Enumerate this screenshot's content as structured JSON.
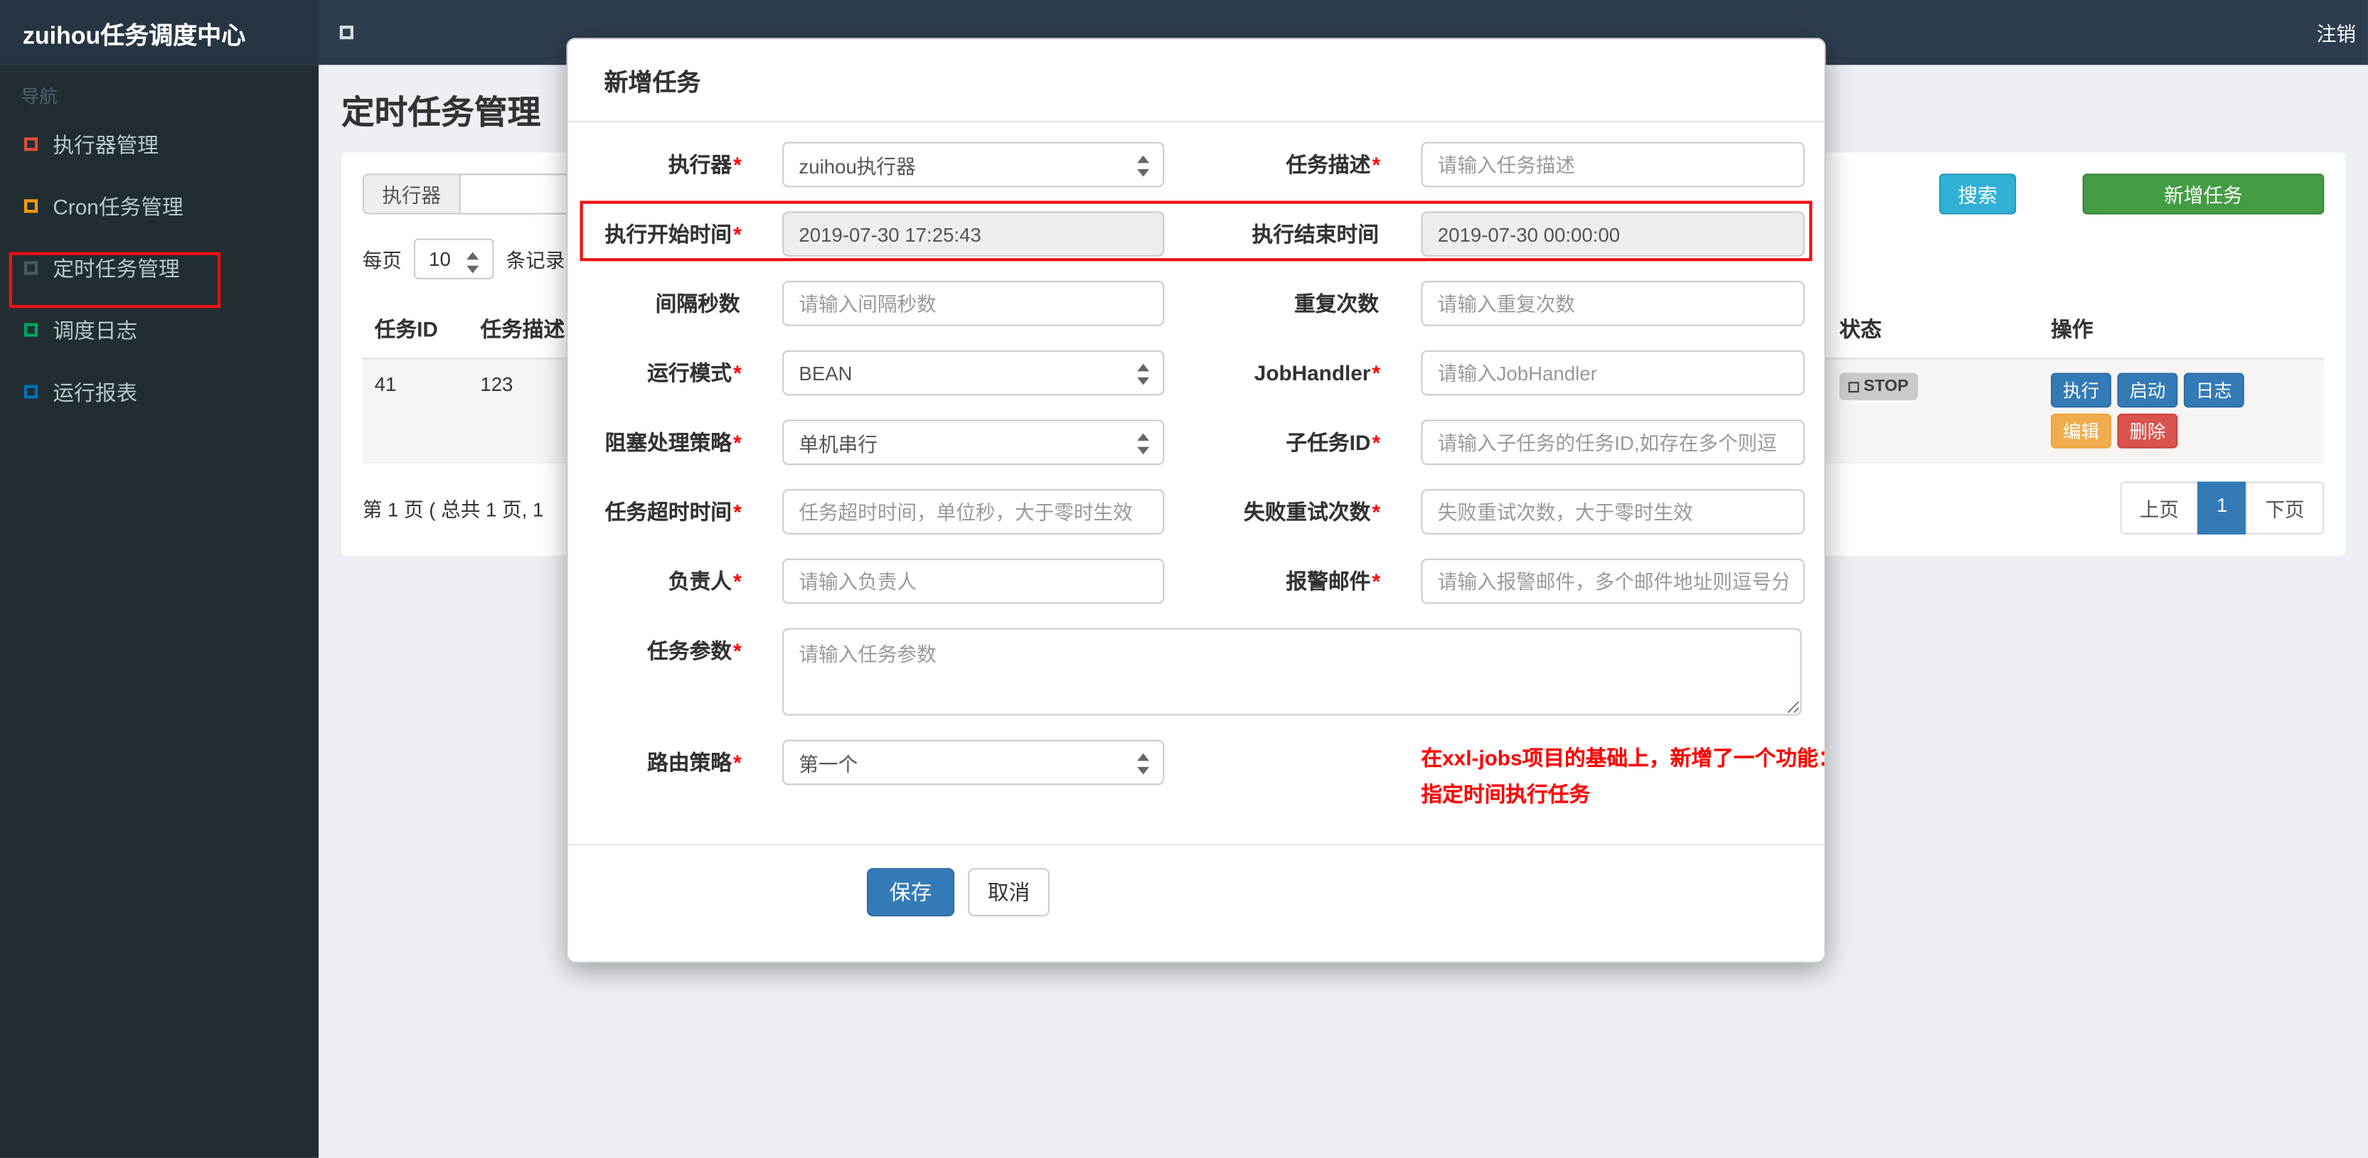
{
  "navbar": {
    "brand": "zuihou任务调度中心",
    "logout": "注销"
  },
  "sidebar": {
    "header": "导航",
    "items": [
      {
        "label": "执行器管理",
        "icon_color": "#dd4b39"
      },
      {
        "label": "Cron任务管理",
        "icon_color": "#f39c12"
      },
      {
        "label": "定时任务管理",
        "icon_color": "#455a64"
      },
      {
        "label": "调度日志",
        "icon_color": "#00a65a"
      },
      {
        "label": "运行报表",
        "icon_color": "#0073b7"
      }
    ]
  },
  "page": {
    "title": "定时任务管理"
  },
  "filter": {
    "executor_label": "执行器",
    "search": "搜索",
    "add_task": "新增任务"
  },
  "per_page": {
    "prefix": "每页",
    "value": "10",
    "suffix": "条记录"
  },
  "table": {
    "headers": [
      "任务ID",
      "任务描述",
      "状态",
      "操作"
    ],
    "row": {
      "id": "41",
      "desc": "123",
      "status": "STOP",
      "ops": [
        "执行",
        "启动",
        "日志",
        "编辑",
        "删除"
      ]
    }
  },
  "pagination": {
    "info": "第 1 页 ( 总共 1 页, 1",
    "prev": "上页",
    "current": "1",
    "next": "下页"
  },
  "modal": {
    "title": "新增任务",
    "fields": {
      "executor": {
        "label": "执行器",
        "required": "*",
        "value": "zuihou执行器"
      },
      "job_desc": {
        "label": "任务描述",
        "required": "*",
        "placeholder": "请输入任务描述"
      },
      "start_time": {
        "label": "执行开始时间",
        "required": "*",
        "value": "2019-07-30 17:25:43"
      },
      "end_time": {
        "label": "执行结束时间",
        "required": "",
        "value": "2019-07-30 00:00:00"
      },
      "interval": {
        "label": "间隔秒数",
        "required": "",
        "placeholder": "请输入间隔秒数"
      },
      "repeat_count": {
        "label": "重复次数",
        "required": "",
        "placeholder": "请输入重复次数"
      },
      "glue_type": {
        "label": "运行模式",
        "required": "*",
        "value": "BEAN"
      },
      "job_handler": {
        "label": "JobHandler",
        "required": "*",
        "placeholder": "请输入JobHandler"
      },
      "block_strategy": {
        "label": "阻塞处理策略",
        "required": "*",
        "value": "单机串行"
      },
      "child_job": {
        "label": "子任务ID",
        "required": "*",
        "placeholder": "请输入子任务的任务ID,如存在多个则逗"
      },
      "timeout": {
        "label": "任务超时时间",
        "required": "*",
        "placeholder": "任务超时时间，单位秒，大于零时生效"
      },
      "fail_retry": {
        "label": "失败重试次数",
        "required": "*",
        "placeholder": "失败重试次数，大于零时生效"
      },
      "author": {
        "label": "负责人",
        "required": "*",
        "placeholder": "请输入负责人"
      },
      "alarm_email": {
        "label": "报警邮件",
        "required": "*",
        "placeholder": "请输入报警邮件，多个邮件地址则逗号分"
      },
      "job_param": {
        "label": "任务参数",
        "required": "*",
        "placeholder": "请输入任务参数"
      },
      "route_strategy": {
        "label": "路由策略",
        "required": "*",
        "value": "第一个"
      }
    },
    "note_line1": "在xxl-jobs项目的基础上，新增了一个功能：",
    "note_line2": "指定时间执行任务",
    "save": "保存",
    "cancel": "取消"
  },
  "colors": {
    "navbar": "#2e3d4e",
    "sidebar": "#222d32",
    "primary_blue": "#337ab7",
    "search_teal": "#31b0d5",
    "add_green": "#449d44",
    "warning_orange": "#f0ad4e",
    "danger_red": "#d9534f",
    "annotation_red": "#ee1111"
  }
}
